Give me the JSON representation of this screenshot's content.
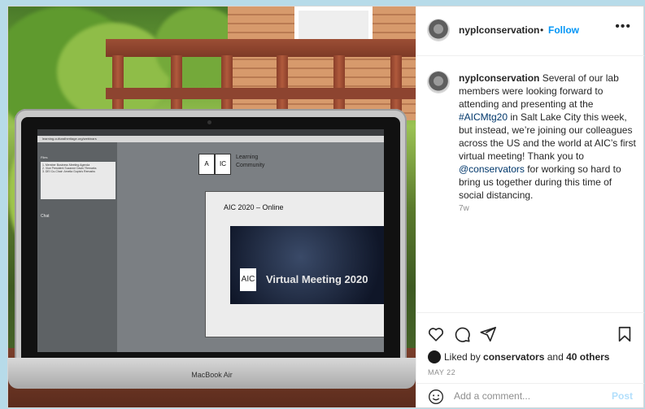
{
  "header": {
    "username": "nyplconservation",
    "separator": "•",
    "follow_label": "Follow",
    "more_label": "•••"
  },
  "photo": {
    "screen": {
      "url_text": "learning.culturalheritage.org/webinars",
      "files_title": "Files",
      "files": [
        "1. Member Business Meeting Agenda",
        "2. Vice President Suzanne Davis' Remarks",
        "3. DEI Co-Chair: Amelia Gupta's Remarks"
      ],
      "chat_label": "Chat",
      "logo_a": "A",
      "logo_b": "IC",
      "learning_community": "Learning Community",
      "slide_title": "AIC 2020 – Online",
      "slide_logo": "AIC",
      "slide_banner": "Virtual Meeting 2020"
    },
    "laptop_brand": "MacBook Air"
  },
  "caption": {
    "username": "nyplconservation",
    "text_1": " Several of our lab members were looking forward to attending and presenting at the ",
    "hashtag": "#AICMtg20",
    "text_2": " in Salt Lake City this week, but instead, we’re joining our colleagues across the US and the world at AIC’s first virtual meeting! Thank you to ",
    "mention": "@conservators",
    "text_3": " for working so hard to bring us together during this time of social distancing.",
    "time_ago": "7w"
  },
  "actions": {
    "icons": [
      "heart-icon",
      "comment-icon",
      "share-icon",
      "bookmark-icon"
    ],
    "liked_by_prefix": "Liked by ",
    "liked_by_user": "conservators",
    "liked_by_and": " and ",
    "liked_by_others": "40 others",
    "date": "MAY 22"
  },
  "comment": {
    "placeholder": "Add a comment...",
    "post_label": "Post"
  },
  "colors": {
    "background": "#b7dbe9",
    "link": "#0095f6",
    "post_disabled": "#b2dffc",
    "text": "#262626",
    "muted": "#8e8e8e"
  }
}
